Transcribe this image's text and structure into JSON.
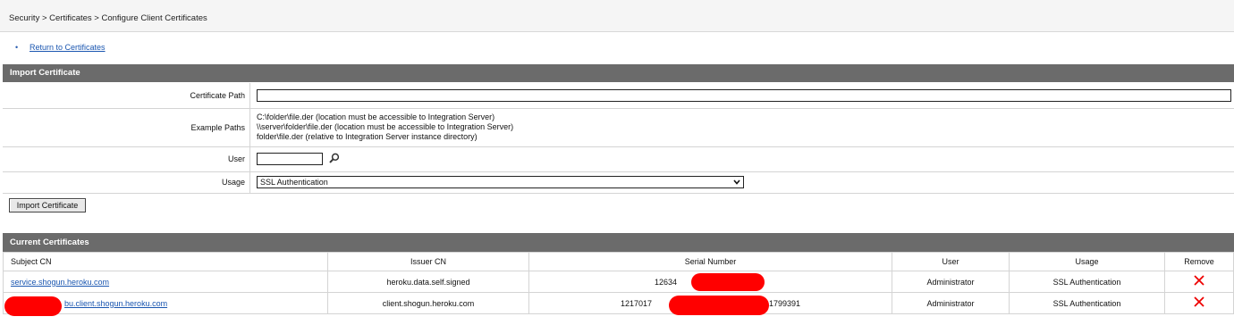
{
  "breadcrumb": "Security > Certificates > Configure Client Certificates",
  "nav": {
    "return_link": "Return to Certificates"
  },
  "import_section": {
    "header": "Import Certificate",
    "certificate_path_label": "Certificate Path",
    "certificate_path_value": "",
    "example_paths_label": "Example Paths",
    "example_paths": [
      "C:\\folder\\file.der (location must be accessible to Integration Server)",
      "\\\\server\\folder\\file.der (location must be accessible to Integration Server)",
      "folder\\file.der (relative to Integration Server instance directory)"
    ],
    "user_label": "User",
    "user_value": "",
    "usage_label": "Usage",
    "usage_selected": "SSL Authentication",
    "import_button": "Import Certificate"
  },
  "current_section": {
    "header": "Current Certificates",
    "columns": [
      "Subject CN",
      "Issuer CN",
      "Serial Number",
      "User",
      "Usage",
      "Remove"
    ],
    "rows": [
      {
        "subject": "service.shogun.heroku.com",
        "issuer": "heroku.data.self.signed",
        "serial": "12634",
        "user": "Administrator",
        "usage": "SSL Authentication"
      },
      {
        "subject": "bu.client.shogun.heroku.com",
        "issuer": "client.shogun.heroku.com",
        "serial_prefix": "1217017",
        "serial_suffix": "1799391",
        "user": "Administrator",
        "usage": "SSL Authentication"
      }
    ]
  },
  "colors": {
    "header_bg": "#6b6b6b",
    "link": "#1a56b0",
    "remove_icon": "#e00000",
    "redaction": "#ff0000"
  },
  "icons": {
    "lookup": "magnifier-icon",
    "remove": "x-icon",
    "dropdown": "chevron-down-icon"
  }
}
